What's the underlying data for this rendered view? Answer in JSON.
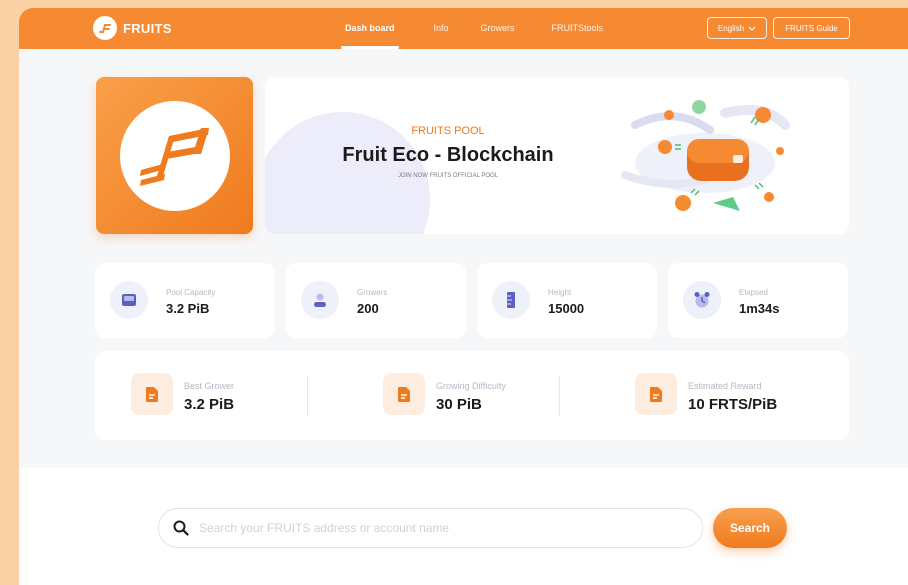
{
  "brand": {
    "name": "FRUITS"
  },
  "nav": {
    "items": [
      {
        "label": "Dash board",
        "active": true
      },
      {
        "label": "Info",
        "active": false
      },
      {
        "label": "Growers",
        "active": false
      },
      {
        "label": "FRUITStools",
        "active": false
      }
    ],
    "language": "English",
    "guide": "FRUITS Guide"
  },
  "banner": {
    "subtitle": "FRUITS POOL",
    "title": "Fruit Eco - Blockchain",
    "tagline": "JOIN NOW FRUITS OFFICIAL POOL"
  },
  "stats": [
    {
      "label": "Pool Capacity",
      "value": "3.2 PiB",
      "icon": "inbox-icon"
    },
    {
      "label": "Growers",
      "value": "200",
      "icon": "user-icon"
    },
    {
      "label": "Height",
      "value": "15000",
      "icon": "ruler-icon"
    },
    {
      "label": "Elapsed",
      "value": "1m34s",
      "icon": "alarm-clock-icon"
    }
  ],
  "highlights": [
    {
      "label": "Best Grower",
      "value": "3.2 PiB",
      "icon": "document-icon"
    },
    {
      "label": "Growing Difficulty",
      "value": "30 PiB",
      "icon": "document-icon"
    },
    {
      "label": "Estimated Reward",
      "value": "10 FRTS/PiB",
      "icon": "document-icon"
    }
  ],
  "search": {
    "placeholder": "Search your FRUITS address or account name",
    "button": "Search"
  },
  "colors": {
    "accent": "#F58A33",
    "accent_dark": "#F07A1E",
    "background": "#FAD1A4",
    "icon_bg": "#EEF0FA",
    "icon_purple": "#5C5FC4"
  }
}
